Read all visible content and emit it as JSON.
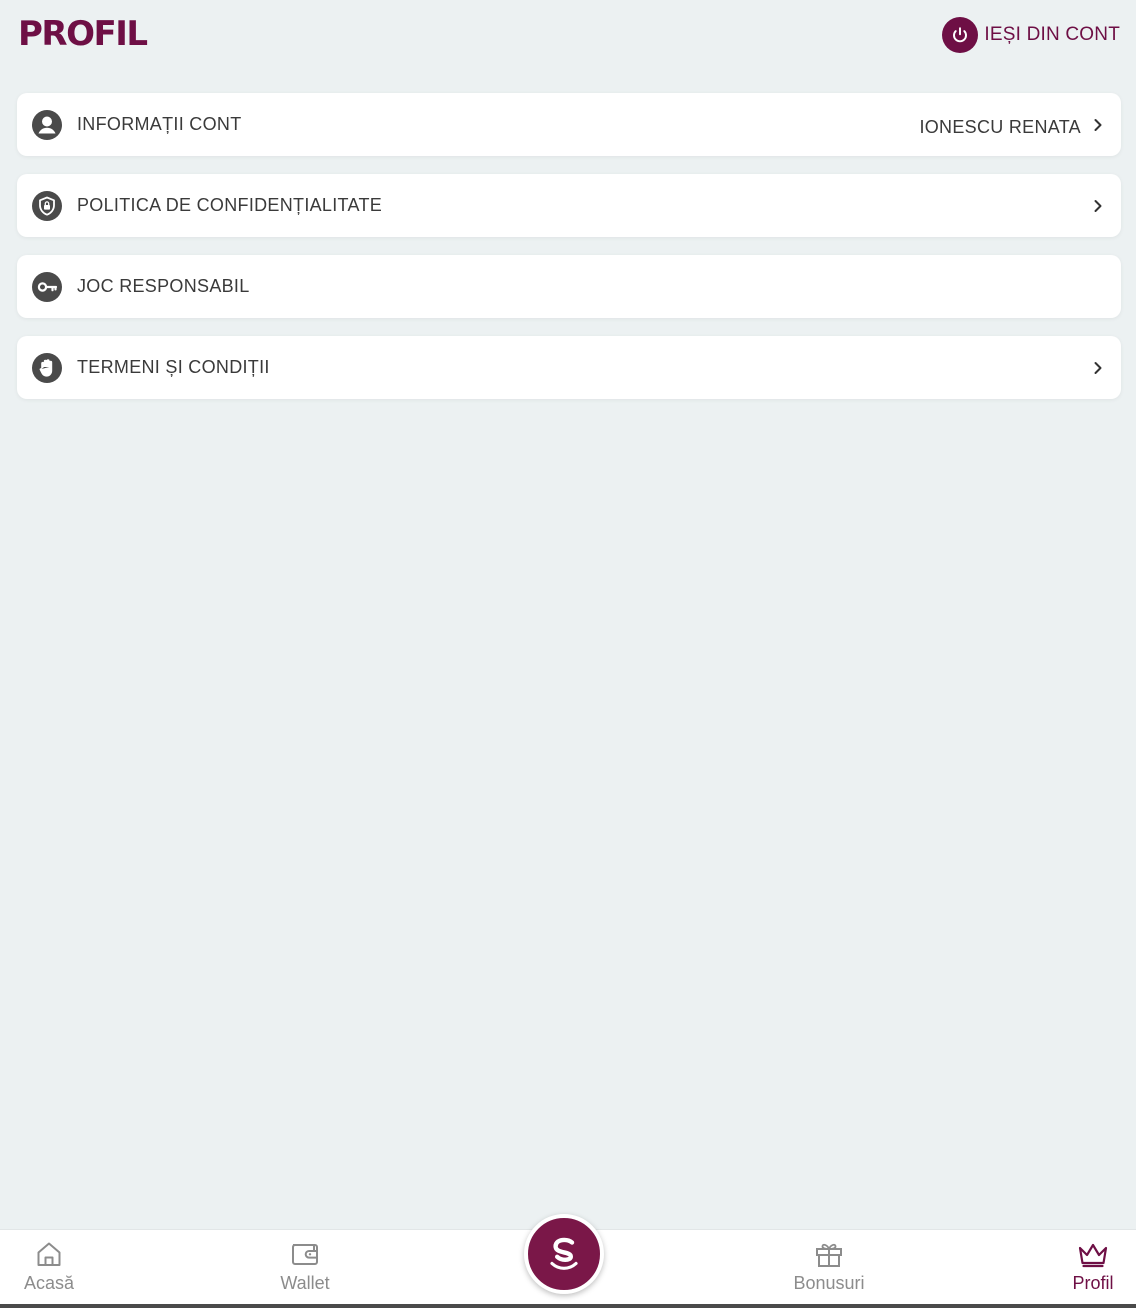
{
  "header": {
    "title": "PROFIL",
    "logout_label": "IEȘI DIN CONT"
  },
  "menu": [
    {
      "label": "INFORMAȚII CONT",
      "value": "IONESCU RENATA",
      "icon": "user-icon",
      "has_chevron": true
    },
    {
      "label": "POLITICA DE CONFIDENȚIALITATE",
      "value": "",
      "icon": "shield-lock-icon",
      "has_chevron": true
    },
    {
      "label": "JOC RESPONSABIL",
      "value": "",
      "icon": "key-icon",
      "has_chevron": false
    },
    {
      "label": "TERMENI ȘI CONDIȚII",
      "value": "",
      "icon": "hand-icon",
      "has_chevron": true
    }
  ],
  "bottom_nav": [
    {
      "label": "Acasă",
      "icon": "home-icon",
      "active": false
    },
    {
      "label": "Wallet",
      "icon": "wallet-icon",
      "active": false
    },
    {
      "label": "",
      "icon": "brand-s-logo-icon",
      "active": false
    },
    {
      "label": "Bonusuri",
      "icon": "gift-icon",
      "active": false
    },
    {
      "label": "Profil",
      "icon": "crown-icon",
      "active": true
    }
  ],
  "colors": {
    "brand": "#6e0f45",
    "background": "#ecf1f2",
    "inactive_nav": "#8c8c8c"
  }
}
